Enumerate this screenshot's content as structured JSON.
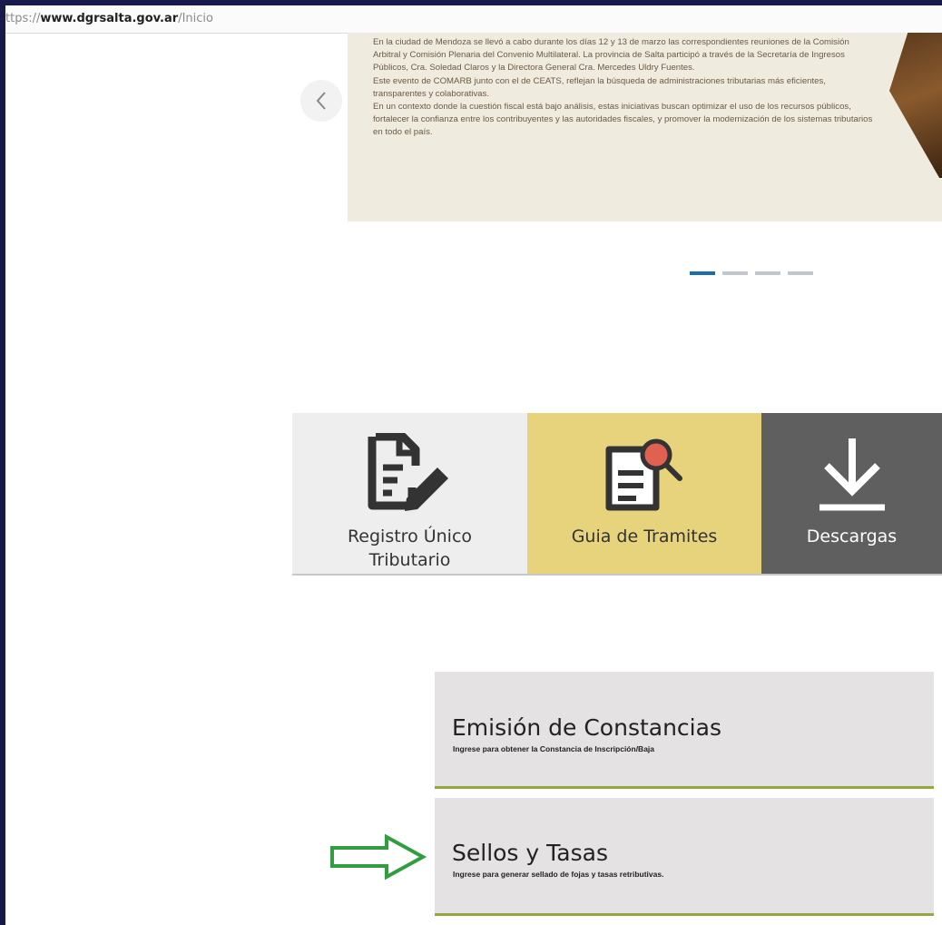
{
  "browser": {
    "url_prefix": "ttps://",
    "url_host": "www.dgrsalta.gov.ar",
    "url_path": "/Inicio"
  },
  "carousel": {
    "paragraphs": [
      "En la ciudad de Mendoza se llevó a cabo durante los días 12 y 13 de marzo las correspondientes reuniones de la Comisión Arbitral y Comisión Plenaria del Convenio Multilateral. La provincia de Salta participó a través de la Secretaría de Ingresos Públicos, Cra. Soledad Claros y la Directora General Cra. Mercedes Uldry Fuentes.",
      "Este evento de COMARB junto con el de CEATS, reflejan la búsqueda de administraciones tributarias más eficientes, transparentes y colaborativas.",
      "En un contexto donde la cuestión fiscal está bajo análisis, estas iniciativas buscan optimizar el uso de los recursos públicos, fortalecer la confianza entre los contribuyentes y las autoridades fiscales, y promover la modernización de los sistemas tributarios en todo el país."
    ],
    "prev_icon": "chevron-left-icon",
    "total_slides": 4,
    "active_slide": 1
  },
  "tiles": [
    {
      "line1": "Registro Único",
      "line2": "Tributario",
      "icon": "document-edit-icon"
    },
    {
      "line1": "Guia de Tramites",
      "icon": "document-search-icon"
    },
    {
      "line1": "Descargas",
      "icon": "download-icon"
    }
  ],
  "services": [
    {
      "title": "Emisión de Constancias",
      "subtitle": "Ingrese para obtener la Constancia de Inscripción/Baja"
    },
    {
      "title": "Sellos y Tasas",
      "subtitle": "Ingrese para generar sellado de fojas y tasas retributivas."
    }
  ],
  "colors": {
    "outer_border": "#171a4a",
    "slide_background": "#f0ebdf",
    "dot_active": "#1b6db1",
    "dot_inactive": "#c2c7cf",
    "tile_registro": "#eeeeee",
    "tile_guia": "#e7d37c",
    "tile_descargas": "#5f5f5f",
    "card_background": "#e4e2e2",
    "card_accent": "#98a53d",
    "annotation_arrow": "#2e9e3e"
  }
}
